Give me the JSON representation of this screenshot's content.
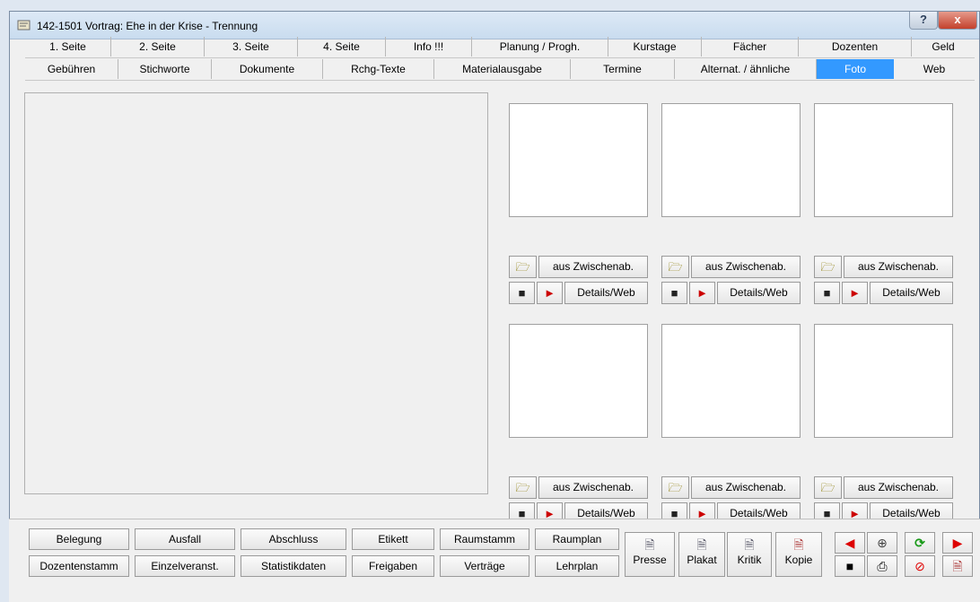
{
  "window": {
    "title": "142-1501 Vortrag: Ehe in der Krise - Trennung",
    "help_glyph": "?",
    "close_glyph": "x"
  },
  "tabs_row1": [
    "1. Seite",
    "2. Seite",
    "3. Seite",
    "4. Seite",
    "Info !!!",
    "Planung / Progh.",
    "Kurstage",
    "Fächer",
    "Dozenten",
    "Geld"
  ],
  "tabs_row2": [
    "Gebühren",
    "Stichworte",
    "Dokumente",
    "Rchg-Texte",
    "Materialausgabe",
    "Termine",
    "Alternat. / ähnliche",
    "Foto",
    "Web"
  ],
  "active_tab": "Foto",
  "photo_slots": {
    "paste_label": "aus Zwischenab.",
    "details_label": "Details/Web",
    "icons": {
      "folder": "folder-icon",
      "delete": "trash-icon",
      "export": "export-icon"
    }
  },
  "bottom": {
    "row1": [
      "Belegung",
      "Ausfall",
      "Abschluss",
      "Etikett",
      "Raumstamm",
      "Raumplan"
    ],
    "row2": [
      "Dozentenstamm",
      "Einzelveranst.",
      "Statistikdaten",
      "Freigaben",
      "Verträge",
      "Lehrplan"
    ],
    "reports": [
      "Presse",
      "Plakat",
      "Kritik",
      "Kopie"
    ]
  },
  "colors": {
    "accent": "#3399ff",
    "close": "#c3412d",
    "refresh": "#1a9a1a",
    "cancel": "#e00000"
  }
}
